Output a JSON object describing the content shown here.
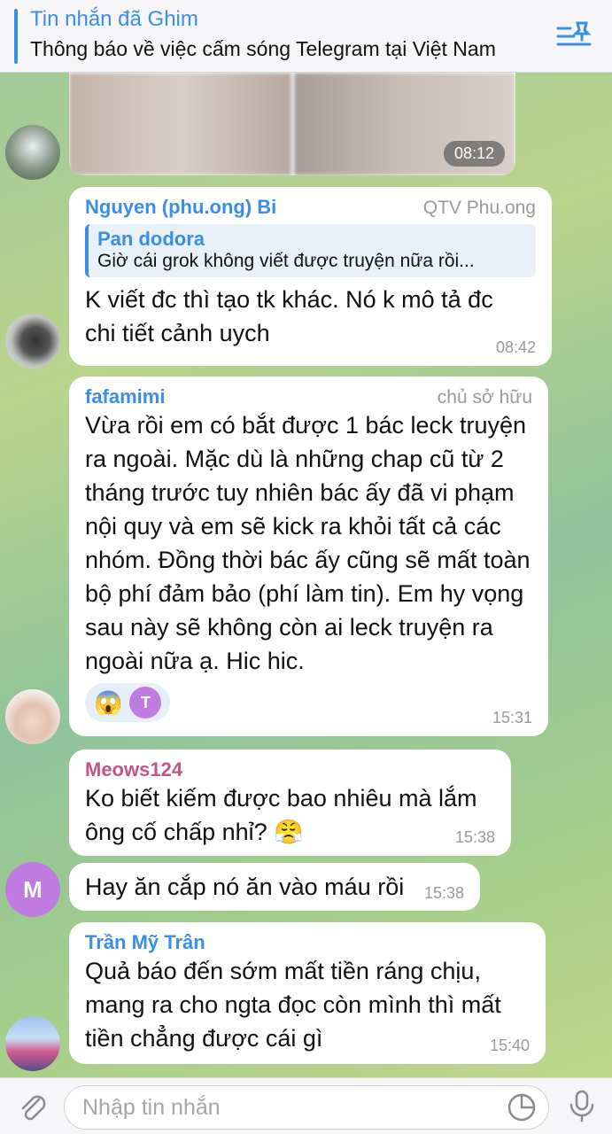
{
  "pinned": {
    "title": "Tin nhắn đã Ghim",
    "text": "Thông báo về việc cấm sóng Telegram tại Việt Nam"
  },
  "media": {
    "time": "08:12"
  },
  "messages": [
    {
      "sender": "Nguyen (phu.ong) Bi",
      "role": "QTV Phu.ong",
      "reply": {
        "name": "Pan dodora",
        "text": "Giờ cái grok không viết được truyện nữa rồi..."
      },
      "text": "K viết đc thì tạo tk khác. Nó k mô tả đc chi tiết cảnh uych",
      "time": "08:42"
    },
    {
      "sender": "fafamimi",
      "role": "chủ sở hữu",
      "text": "Vừa rồi em có bắt được 1 bác leck truyện ra ngoài. Mặc dù là những chap cũ từ 2 tháng trước tuy nhiên bác ấy đã vi phạm nội quy và em sẽ kick ra khỏi tất cả các nhóm. Đồng thời bác ấy cũng sẽ mất toàn bộ phí đảm bảo (phí làm tin). Em hy vọng sau này sẽ không còn ai leck truyện ra ngoài nữa ạ. Hic hic.",
      "reaction": {
        "emoji": "😱",
        "avatar": "T"
      },
      "time": "15:31"
    },
    {
      "sender": "Meows124",
      "text": "Ko biết kiếm được bao nhiêu mà lắm ông cố chấp nhỉ? 😤",
      "time": "15:38"
    },
    {
      "avatar": "M",
      "text": "Hay ăn cắp nó ăn vào máu rồi",
      "time": "15:38"
    },
    {
      "sender": "Trần Mỹ Trân",
      "text": "Quả báo đến sớm mất tiền ráng chịu, mang ra cho ngta đọc còn mình thì mất tiền chẳng được cái gì",
      "time": "15:40"
    }
  ],
  "composer": {
    "placeholder": "Nhập tin nhắn"
  },
  "colors": {
    "accent": "#3a8ee6",
    "sender_fafamimi": "#3a8ee6",
    "sender_nguyen": "#3a8ee6",
    "sender_meows": "#c2548a",
    "sender_tran": "#3a8ee6"
  },
  "icons": [
    "pin-list-icon",
    "attach-icon",
    "sticker-icon",
    "microphone-icon"
  ]
}
